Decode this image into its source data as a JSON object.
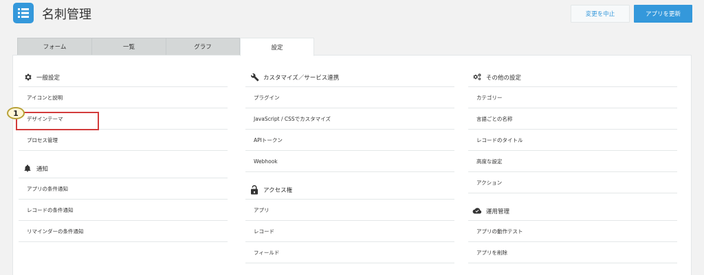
{
  "app": {
    "title": "名刺管理",
    "icon": "list-icon"
  },
  "buttons": {
    "cancel": "変更を中止",
    "update": "アプリを更新"
  },
  "colors": {
    "accent": "#3498db",
    "highlight": "#d23b3b"
  },
  "tabs": [
    {
      "label": "フォーム"
    },
    {
      "label": "一覧"
    },
    {
      "label": "グラフ"
    },
    {
      "label": "設定"
    }
  ],
  "callout": {
    "number": "1"
  },
  "columns": [
    {
      "sections": [
        {
          "title": "一般設定",
          "icon": "gear-icon",
          "items": [
            "アイコンと説明",
            "デザインテーマ",
            "プロセス管理"
          ]
        },
        {
          "title": "通知",
          "icon": "bell-icon",
          "items": [
            "アプリの条件通知",
            "レコードの条件通知",
            "リマインダーの条件通知"
          ]
        }
      ]
    },
    {
      "sections": [
        {
          "title": "カスタマイズ／サービス連携",
          "icon": "wrench-icon",
          "items": [
            "プラグイン",
            "JavaScript / CSSでカスタマイズ",
            "APIトークン",
            "Webhook"
          ]
        },
        {
          "title": "アクセス権",
          "icon": "lock-icon",
          "items": [
            "アプリ",
            "レコード",
            "フィールド"
          ]
        }
      ]
    },
    {
      "sections": [
        {
          "title": "その他の設定",
          "icon": "gears-icon",
          "items": [
            "カテゴリー",
            "言語ごとの名称",
            "レコードのタイトル",
            "高度な設定",
            "アクション"
          ]
        },
        {
          "title": "運用管理",
          "icon": "cloud-icon",
          "items": [
            "アプリの動作テスト",
            "アプリを削除"
          ]
        }
      ]
    }
  ]
}
